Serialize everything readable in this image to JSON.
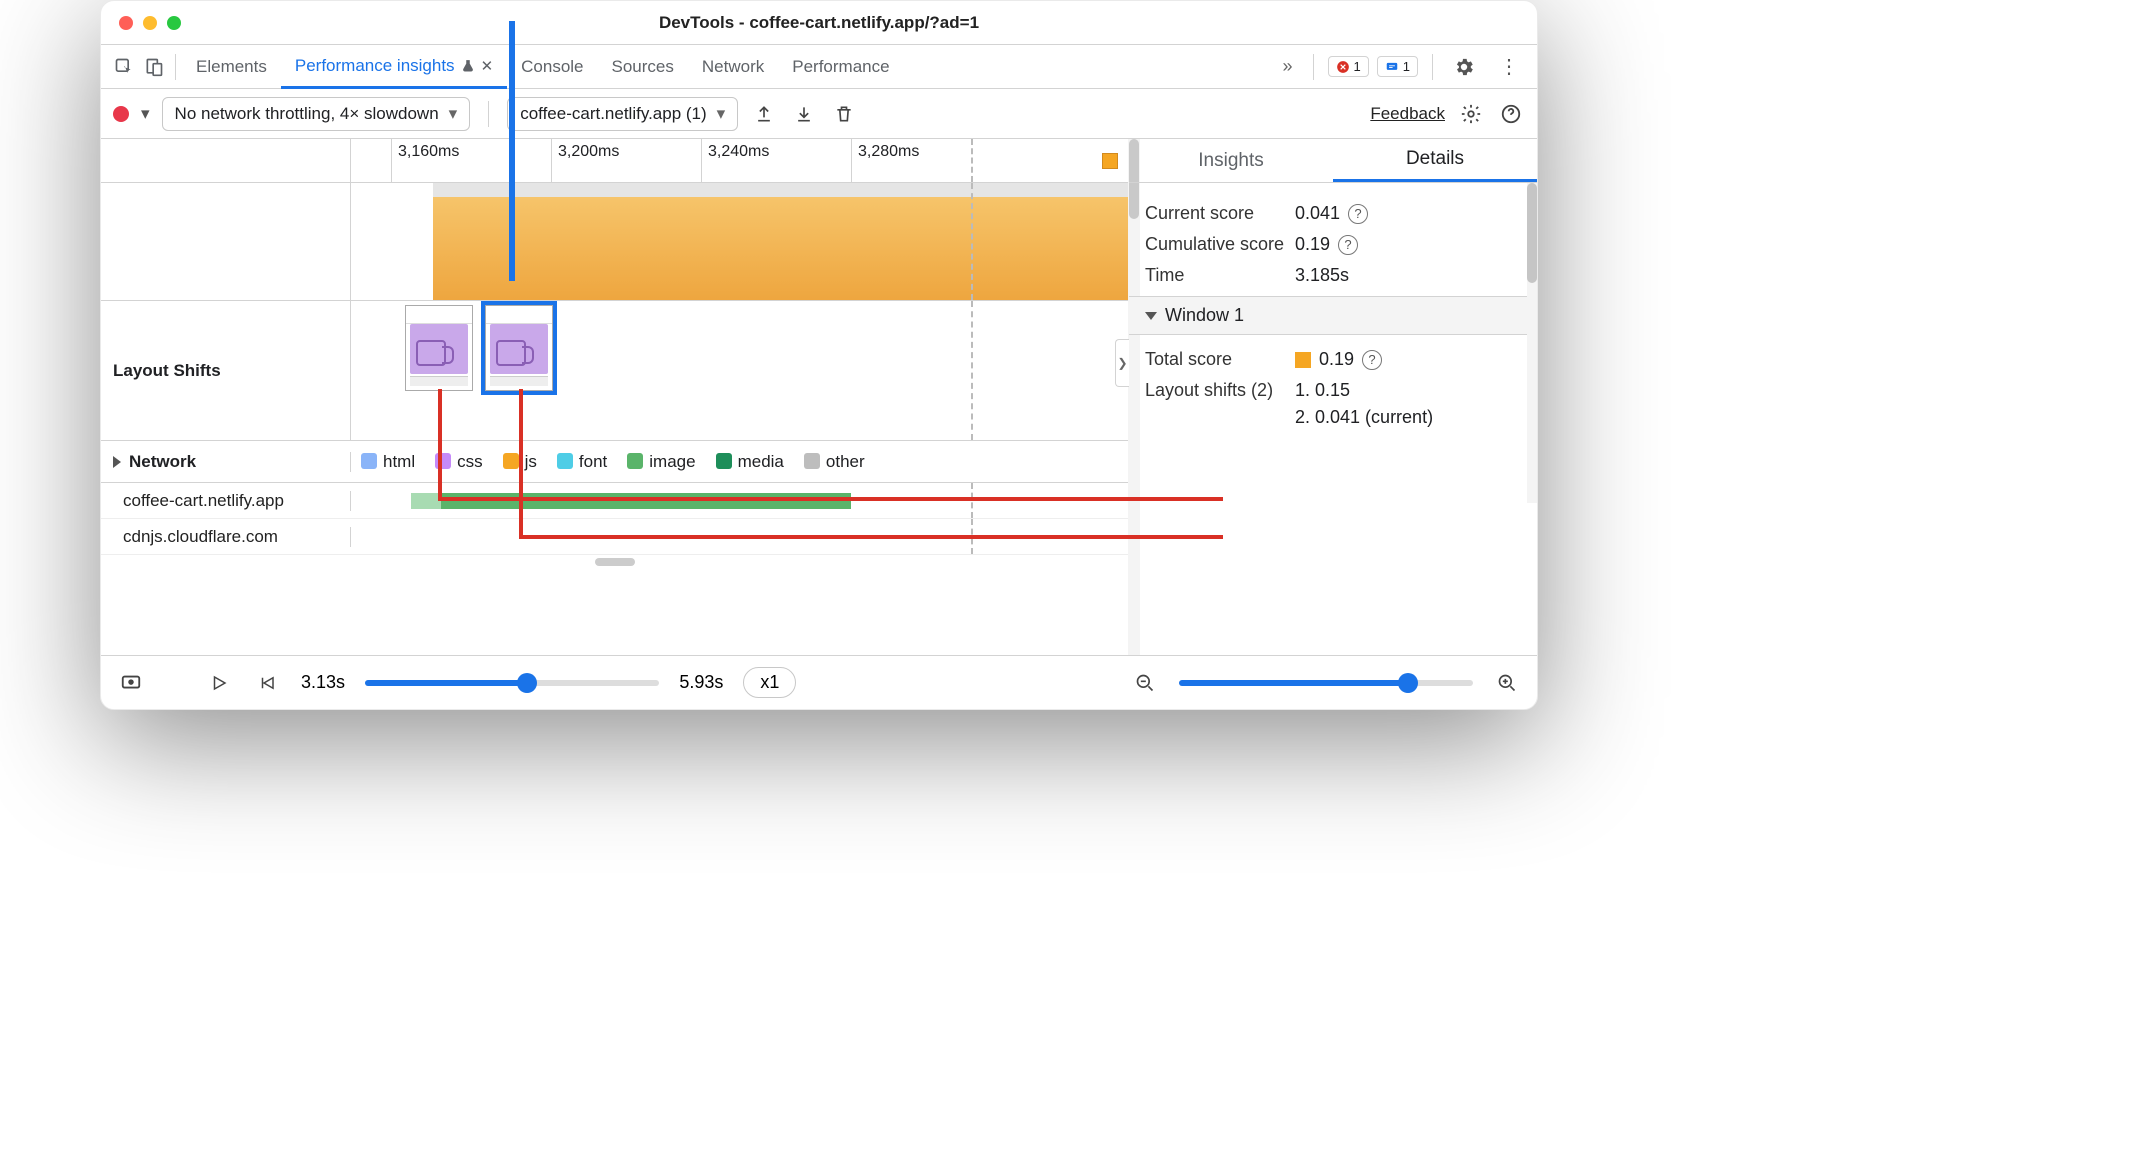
{
  "window": {
    "title": "DevTools - coffee-cart.netlify.app/?ad=1"
  },
  "tabs": {
    "elements": "Elements",
    "perf_insights": "Performance insights",
    "console": "Console",
    "sources": "Sources",
    "network": "Network",
    "performance": "Performance"
  },
  "badges": {
    "errors": "1",
    "messages": "1"
  },
  "toolbar": {
    "throttling": "No network throttling, 4× slowdown",
    "recording_select": "coffee-cart.netlify.app (1)",
    "feedback": "Feedback"
  },
  "ruler": {
    "t0": "3,160ms",
    "t1": "3,200ms",
    "t2": "3,240ms",
    "t3": "3,280ms"
  },
  "rows": {
    "layout_shifts": "Layout Shifts",
    "network": "Network",
    "host1": "coffee-cart.netlify.app",
    "host2": "cdnjs.cloudflare.com"
  },
  "legend": {
    "html": "html",
    "css": "css",
    "js": "js",
    "font": "font",
    "image": "image",
    "media": "media",
    "other": "other"
  },
  "sidebar": {
    "tab_insights": "Insights",
    "tab_details": "Details",
    "current_score_k": "Current score",
    "current_score_v": "0.041",
    "cumulative_score_k": "Cumulative score",
    "cumulative_score_v": "0.19",
    "time_k": "Time",
    "time_v": "3.185s",
    "window_label": "Window 1",
    "total_score_k": "Total score",
    "total_score_v": "0.19",
    "layout_shifts_k": "Layout shifts (2)",
    "ls1": "1. 0.15",
    "ls2": "2. 0.041 (current)"
  },
  "footer": {
    "t_start": "3.13s",
    "t_end": "5.93s",
    "speed": "x1"
  },
  "colors": {
    "html": "#8ab4f8",
    "css": "#c58af9",
    "js": "#f5a623",
    "font": "#4ecde6",
    "image": "#5ab46a",
    "media": "#1e8e5a",
    "other": "#bdbdbd"
  }
}
